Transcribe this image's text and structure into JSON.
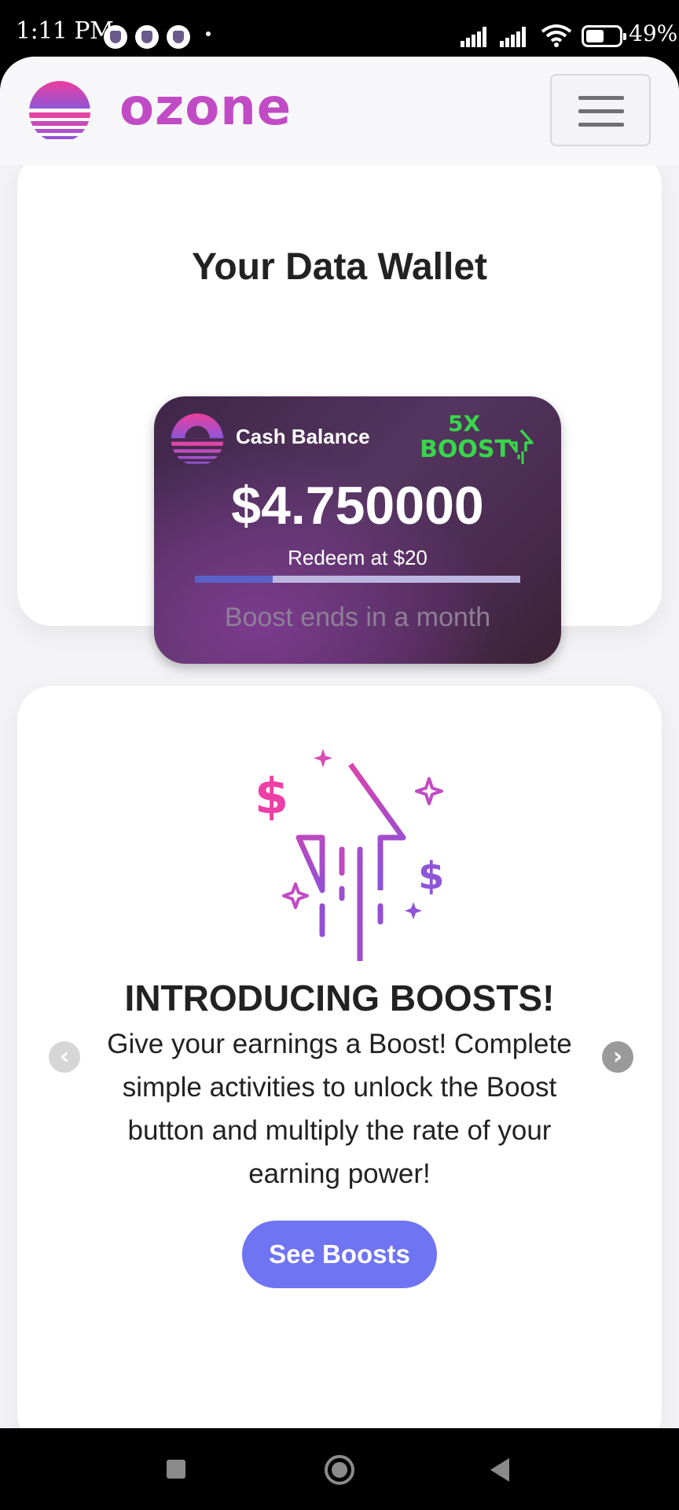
{
  "status_bar": {
    "time": "1:11 PM",
    "battery": "49%",
    "icons": [
      "notification-icon",
      "notification-icon",
      "notification-icon",
      "signal-icon",
      "signal-icon",
      "wifi-icon",
      "battery-icon"
    ]
  },
  "header": {
    "logo_text": "ozone",
    "brand_color": "#c14bc4"
  },
  "wallet": {
    "title": "Your Data Wallet",
    "card_label": "Cash Balance",
    "boost_multiplier": "5X",
    "boost_word": "BOOST",
    "amount": "$4.750000",
    "redeem_text": "Redeem at $20",
    "progress_fraction": 0.24,
    "boost_ends": "Boost ends in a month"
  },
  "intro": {
    "title": "INTRODUCING BOOSTS!",
    "body": "Give your earnings a Boost! Complete simple activities to unlock the Boost button and multiply the rate of your earning power!",
    "button_label": "See Boosts",
    "accent_color": "#6f74f2",
    "carousel_slides": 3,
    "active_slide": 1
  }
}
